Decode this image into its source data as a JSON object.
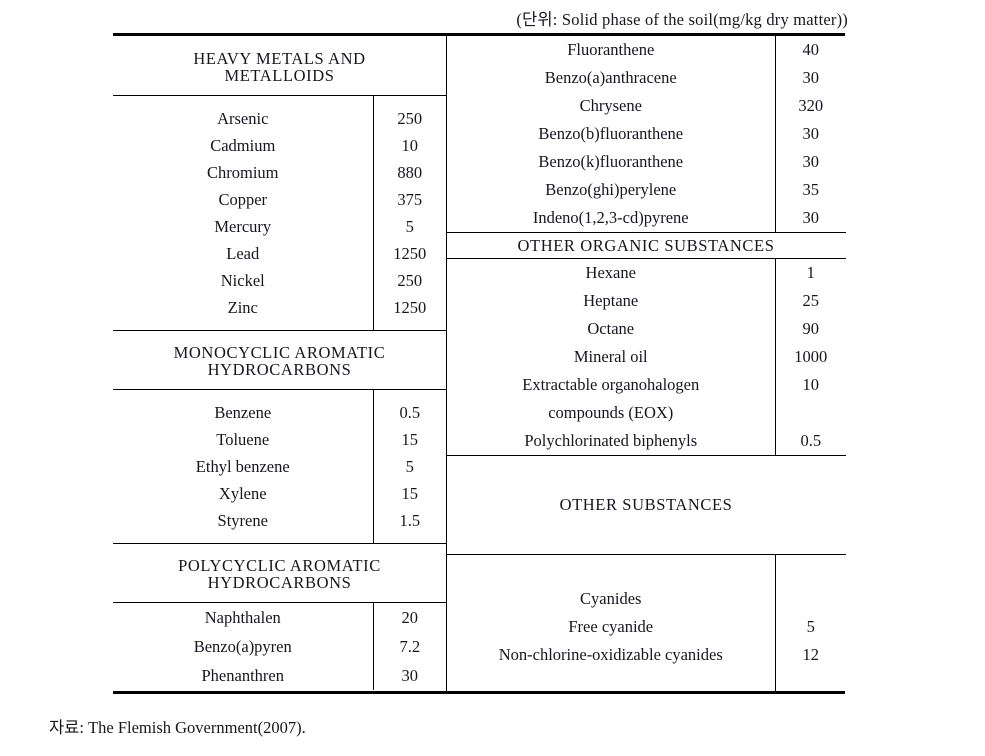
{
  "caption": {
    "unit_note": "(단위: Solid phase of the soil(mg/kg dry matter))"
  },
  "source": {
    "note": "자료: The Flemish Government(2007)."
  },
  "table": {
    "left_column": {
      "sections": [
        {
          "heading_lines": [
            "HEAVY METALS AND",
            "METALLOIDS"
          ],
          "rows": [
            {
              "name": "Arsenic",
              "value": "250"
            },
            {
              "name": "Cadmium",
              "value": "10"
            },
            {
              "name": "Chromium",
              "value": "880"
            },
            {
              "name": "Copper",
              "value": "375"
            },
            {
              "name": "Mercury",
              "value": "5"
            },
            {
              "name": "Lead",
              "value": "1250"
            },
            {
              "name": "Nickel",
              "value": "250"
            },
            {
              "name": "Zinc",
              "value": "1250"
            }
          ]
        },
        {
          "heading_lines": [
            "MONOCYCLIC AROMATIC",
            "HYDROCARBONS"
          ],
          "rows": [
            {
              "name": "Benzene",
              "value": "0.5"
            },
            {
              "name": "Toluene",
              "value": "15"
            },
            {
              "name": "Ethyl benzene",
              "value": "5"
            },
            {
              "name": "Xylene",
              "value": "15"
            },
            {
              "name": "Styrene",
              "value": "1.5"
            }
          ]
        },
        {
          "heading_lines": [
            "POLYCYCLIC AROMATIC",
            "HYDROCARBONS"
          ],
          "rows": [
            {
              "name": "Naphthalen",
              "value": "20"
            },
            {
              "name": "Benzo(a)pyren",
              "value": "7.2"
            },
            {
              "name": "Phenanthren",
              "value": "30"
            }
          ]
        }
      ]
    },
    "right_column": {
      "sections": [
        {
          "heading_lines": [],
          "rows": [
            {
              "name": "Fluoranthene",
              "value": "40"
            },
            {
              "name": "Benzo(a)anthracene",
              "value": "30"
            },
            {
              "name": "Chrysene",
              "value": "320"
            },
            {
              "name": "Benzo(b)fluoranthene",
              "value": "30"
            },
            {
              "name": "Benzo(k)fluoranthene",
              "value": "30"
            },
            {
              "name": "Benzo(ghi)perylene",
              "value": "35"
            },
            {
              "name": "Indeno(1,2,3-cd)pyrene",
              "value": "30"
            }
          ]
        },
        {
          "heading_lines": [
            "OTHER ORGANIC SUBSTANCES"
          ],
          "rows": [
            {
              "name": "Hexane",
              "value": "1"
            },
            {
              "name": "Heptane",
              "value": "25"
            },
            {
              "name": "Octane",
              "value": "90"
            },
            {
              "name": "Mineral oil",
              "value": "1000"
            },
            {
              "name": "Extractable organohalogen",
              "value": "10"
            },
            {
              "name": "compounds (EOX)",
              "value": ""
            },
            {
              "name": "Polychlorinated biphenyls",
              "value": "0.5"
            }
          ]
        },
        {
          "heading_lines": [
            "OTHER SUBSTANCES"
          ],
          "rows": [
            {
              "name": "Cyanides",
              "value": ""
            },
            {
              "name": "Free cyanide",
              "value": "5"
            },
            {
              "name": "Non-chlorine-oxidizable cyanides",
              "value": "12"
            }
          ]
        }
      ]
    }
  }
}
